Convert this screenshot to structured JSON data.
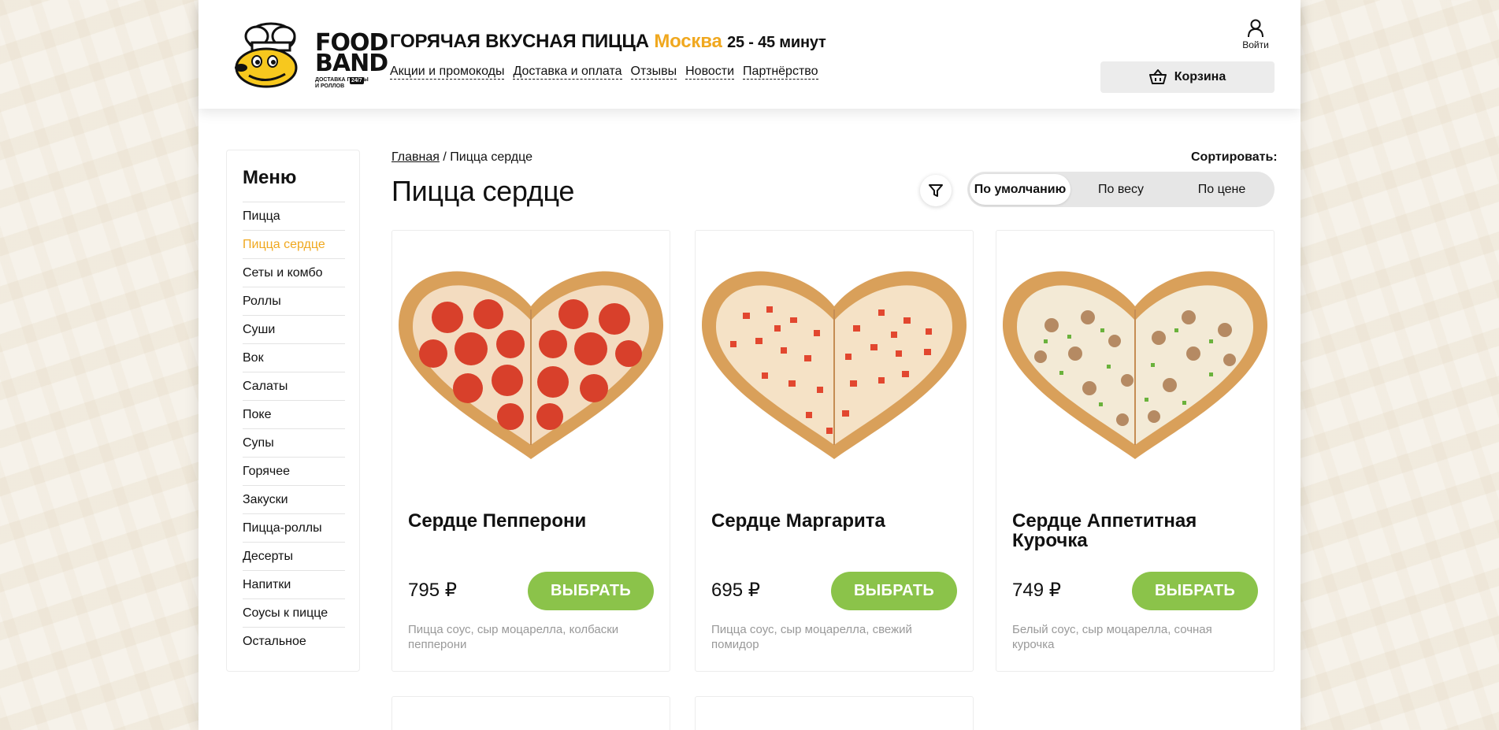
{
  "logo": {
    "line1": "FOOD",
    "line2": "BAND",
    "sub": "ДОСТАВКА ПИЦЦЫ И РОЛЛОВ",
    "badge": "24/7"
  },
  "header": {
    "tagline_main": "ГОРЯЧАЯ ВКУСНАЯ ПИЦЦА",
    "city": "Москва",
    "delivery_time": "25 - 45 минут",
    "nav": [
      "Акции и промокоды",
      "Доставка и оплата",
      "Отзывы",
      "Новости",
      "Партнёрство"
    ],
    "login_label": "Войти",
    "cart_label": "Корзина"
  },
  "sidebar": {
    "title": "Меню",
    "items": [
      "Пицца",
      "Пицца сердце",
      "Сеты и комбо",
      "Роллы",
      "Суши",
      "Вок",
      "Салаты",
      "Поке",
      "Супы",
      "Горячее",
      "Закуски",
      "Пицца-роллы",
      "Десерты",
      "Напитки",
      "Соусы к пицце",
      "Остальное"
    ],
    "active_index": 1
  },
  "breadcrumb": {
    "home": "Главная",
    "separator": "/",
    "current": "Пицца сердце"
  },
  "page_title": "Пицца сердце",
  "sort": {
    "label": "Сортировать:",
    "options": [
      "По умолчанию",
      "По весу",
      "По цене"
    ],
    "active_index": 0
  },
  "products": [
    {
      "name": "Сердце Пепперони",
      "price": "795 ₽",
      "button": "ВЫБРАТЬ",
      "description": "Пицца соус, сыр моцарелла, колбаски пепперони",
      "topping": "pepperoni"
    },
    {
      "name": "Сердце Маргарита",
      "price": "695 ₽",
      "button": "ВЫБРАТЬ",
      "description": "Пицца соус, сыр моцарелла, свежий помидор",
      "topping": "tomato"
    },
    {
      "name": "Сердце Аппетитная Курочка",
      "price": "749 ₽",
      "button": "ВЫБРАТЬ",
      "description": "Белый соус, сыр моцарелла, сочная курочка",
      "topping": "chicken"
    }
  ],
  "colors": {
    "accent_orange": "#f0a81f",
    "button_green": "#8bc34a",
    "active_sort_bg": "#ffffff"
  }
}
